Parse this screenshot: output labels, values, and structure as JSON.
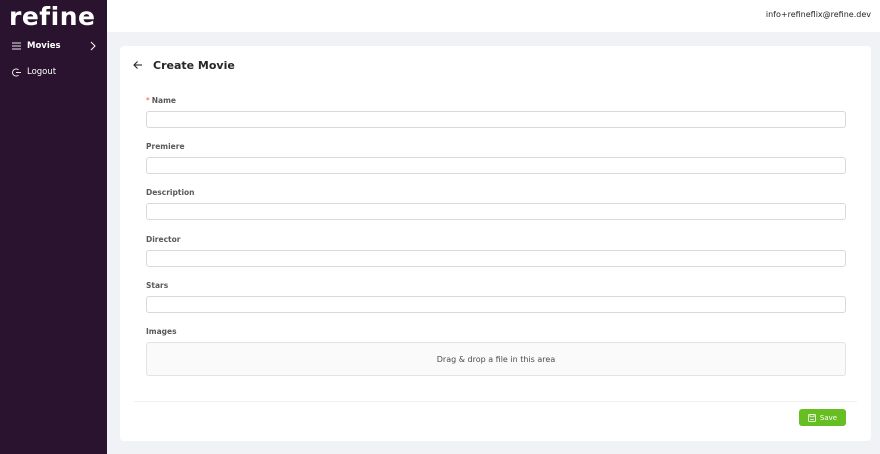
{
  "sidebar": {
    "logo": "refine",
    "items": [
      {
        "label": "Movies",
        "icon": "list-icon",
        "active": true
      },
      {
        "label": "Logout",
        "icon": "logout-icon",
        "active": false
      }
    ]
  },
  "header": {
    "user_email": "info+refineflix@refine.dev"
  },
  "page": {
    "title": "Create Movie",
    "fields": {
      "name": {
        "label": "Name",
        "required": true,
        "value": ""
      },
      "premiere": {
        "label": "Premiere",
        "value": ""
      },
      "description": {
        "label": "Description",
        "value": ""
      },
      "director": {
        "label": "Director",
        "value": ""
      },
      "stars": {
        "label": "Stars",
        "value": ""
      },
      "images": {
        "label": "Images",
        "dropzone_text": "Drag & drop a file in this area"
      }
    },
    "save_label": "Save"
  },
  "colors": {
    "sidebar_bg": "#2a132e",
    "save_green": "#67be23",
    "page_bg": "#f0f2f5"
  }
}
